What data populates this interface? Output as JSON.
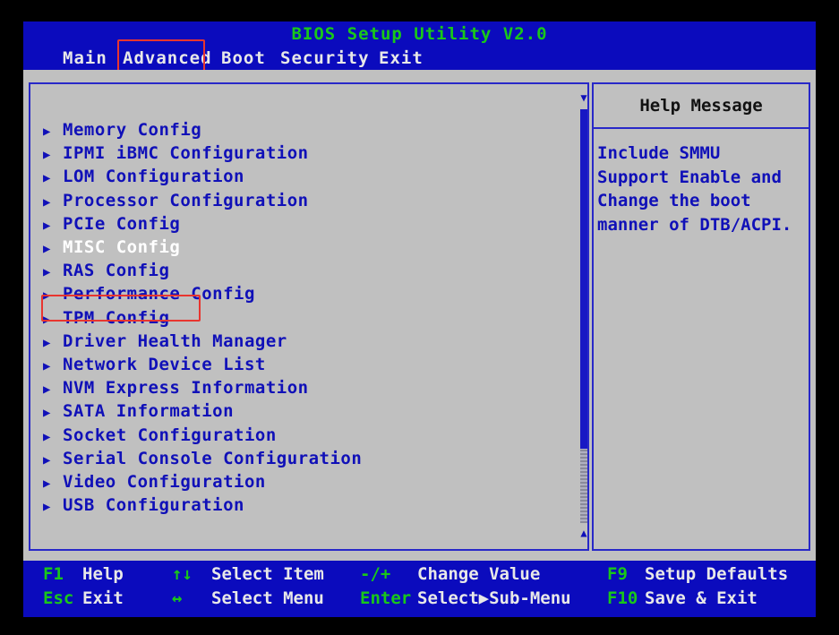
{
  "title": "BIOS Setup Utility V2.0",
  "menu": {
    "tabs": [
      "Main",
      "Advanced",
      "Boot",
      "Security",
      "Exit"
    ],
    "active": "Advanced"
  },
  "items": [
    "Memory Config",
    "IPMI iBMC Configuration",
    "LOM Configuration",
    "Processor Configuration",
    "PCIe Config",
    "MISC Config",
    "RAS Config",
    "Performance Config",
    "TPM Config",
    "Driver Health Manager",
    "Network Device List",
    "NVM Express Information",
    "SATA Information",
    "Socket Configuration",
    "Serial Console Configuration",
    "Video Configuration",
    "USB Configuration"
  ],
  "selected_item": "MISC Config",
  "scroll": {
    "visible_fraction": 0.82
  },
  "help": {
    "header": "Help Message",
    "text": "Include SMMU\nSupport Enable and\nChange the boot\nmanner of DTB/ACPI."
  },
  "footer": {
    "keys": [
      {
        "key": "F1",
        "desc": "Help"
      },
      {
        "key": "Esc",
        "desc": "Exit"
      },
      {
        "key": "↑↓",
        "desc": "Select Item"
      },
      {
        "key": "↔",
        "desc": "Select Menu"
      },
      {
        "key": "-/+",
        "desc": "Change Value"
      },
      {
        "key": "Enter",
        "desc": "Select▶Sub-Menu"
      },
      {
        "key": "F9",
        "desc": "Setup Defaults"
      },
      {
        "key": "F10",
        "desc": "Save & Exit"
      }
    ]
  },
  "colors": {
    "background": "#0b0bbd",
    "panel": "#c0c0c0",
    "item_text": "#1010b8",
    "key_text": "#19c819",
    "highlight_box": "#e8352f"
  }
}
